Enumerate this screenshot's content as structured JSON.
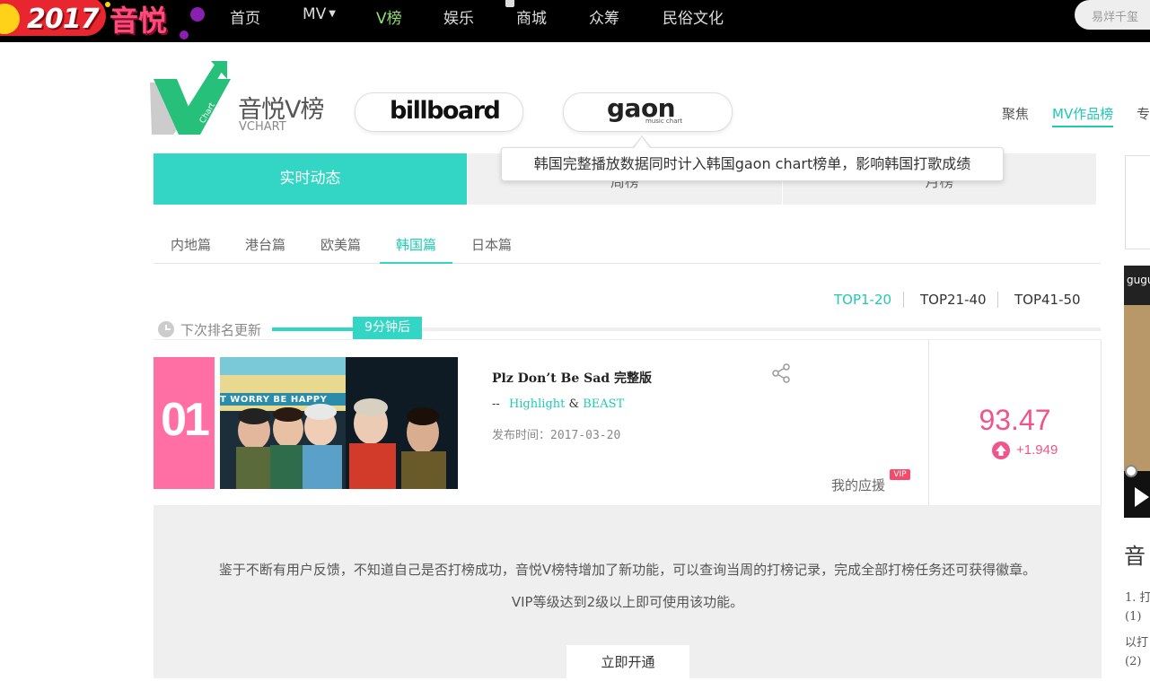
{
  "top_nav": {
    "logo_year": "2017",
    "logo_brand": "音悦",
    "items": [
      "首页",
      "MV",
      "V榜",
      "娱乐",
      "商城",
      "众筹",
      "民俗文化"
    ],
    "search_placeholder": "易烊千玺"
  },
  "vchart": {
    "title": "音悦V榜",
    "subtitle": "VCHART",
    "billboard": "billboard",
    "gaon": "gaon",
    "gaon_sub": "music chart",
    "right_nav": [
      "聚焦",
      "MV作品榜",
      "专"
    ]
  },
  "period_tabs": [
    "实时动态",
    "周榜",
    "月榜"
  ],
  "tooltip": "韩国完整播放数据同时计入韩国gaon chart榜单，影响韩国打歌成绩",
  "regions": [
    "内地篇",
    "港台篇",
    "欧美篇",
    "韩国篇",
    "日本篇"
  ],
  "ranges": [
    "TOP1-20",
    "TOP21-40",
    "TOP41-50"
  ],
  "update": {
    "label": "下次排名更新",
    "countdown": "9分钟后"
  },
  "entry": {
    "rank": "01",
    "title": "Plz Don’t Be Sad 完整版",
    "artist_prefix": "--",
    "artist1": "Highlight",
    "artist_sep": "&",
    "artist2": "BEAST",
    "release": "发布时间：2017-03-20",
    "support_label": "我的应援",
    "vip": "VIP",
    "score": "93.47",
    "delta": "+1.949",
    "banner_text": "T WORRY BE HAPPY"
  },
  "notice": {
    "line1": "鉴于不断有用户反馈，不知道自己是否打榜成功，音悦V榜特增加了新功能，可以查询当周的打榜记录，完成全部打榜任务还可获得徽章。",
    "line2": "VIP等级达到2级以上即可使用该功能。",
    "button": "立即开通"
  },
  "side": {
    "video_label": "gugu",
    "title": "音",
    "lines": [
      "1. 打",
      "(1)",
      "以打",
      "(2)"
    ]
  },
  "colors": {
    "accent": "#33d6c5",
    "pink": "#f0548a",
    "rank_bg": "#ff6fa3"
  }
}
